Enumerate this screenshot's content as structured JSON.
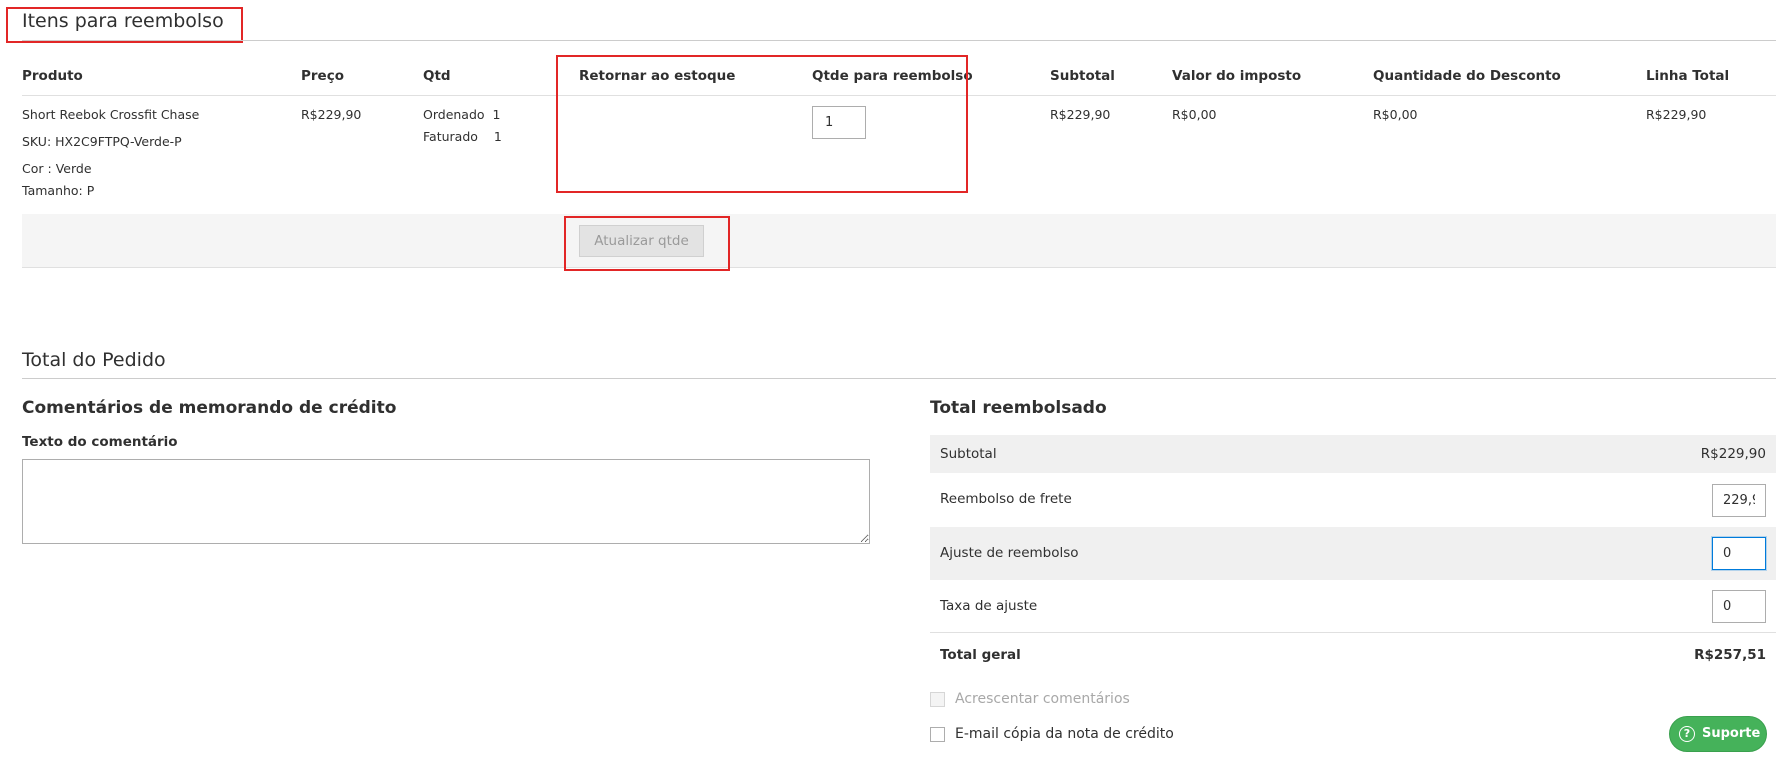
{
  "items_section": {
    "title": "Itens para reembolso"
  },
  "table": {
    "headers": {
      "product": "Produto",
      "price": "Preço",
      "qty": "Qtd",
      "return_stock": "Retornar ao estoque",
      "refund_qty": "Qtde para reembolso",
      "subtotal": "Subtotal",
      "tax": "Valor do imposto",
      "discount": "Quantidade do Desconto",
      "row_total": "Linha Total"
    },
    "row": {
      "product_name": "Short Reebok Crossfit Chase",
      "sku": "SKU: HX2C9FTPQ-Verde-P",
      "option_color_label": "Cor :",
      "option_color_value": "Verde",
      "option_size_label": "Tamanho:",
      "option_size_value": "P",
      "price": "R$229,90",
      "ordered_label": "Ordenado",
      "ordered_value": "1",
      "invoiced_label": "Faturado",
      "invoiced_value": "1",
      "refund_qty": "1",
      "subtotal": "R$229,90",
      "tax": "R$0,00",
      "discount": "R$0,00",
      "row_total": "R$229,90"
    },
    "update_button": "Atualizar qtde"
  },
  "order_total": {
    "title": "Total do Pedido",
    "comments": {
      "title": "Comentários de memorando de crédito",
      "label": "Texto do comentário",
      "value": ""
    },
    "refund": {
      "title": "Total reembolsado",
      "subtotal_label": "Subtotal",
      "subtotal_value": "R$229,90",
      "shipping_label": "Reembolso de frete",
      "shipping_value": "229,9",
      "adjustment_label": "Ajuste de reembolso",
      "adjustment_value": "0",
      "fee_label": "Taxa de ajuste",
      "fee_value": "0",
      "grand_total_label": "Total geral",
      "grand_total_value": "R$257,51"
    },
    "append_comments": "Acrescentar comentários",
    "email_copy": "E-mail cópia da nota de crédito"
  },
  "support": {
    "label": "Suporte",
    "icon": "help-circle-icon"
  },
  "colors": {
    "highlight": "#e22626",
    "support_bg": "#45b25a",
    "focus": "#007bdb",
    "row_gray": "#f0f0f0"
  }
}
